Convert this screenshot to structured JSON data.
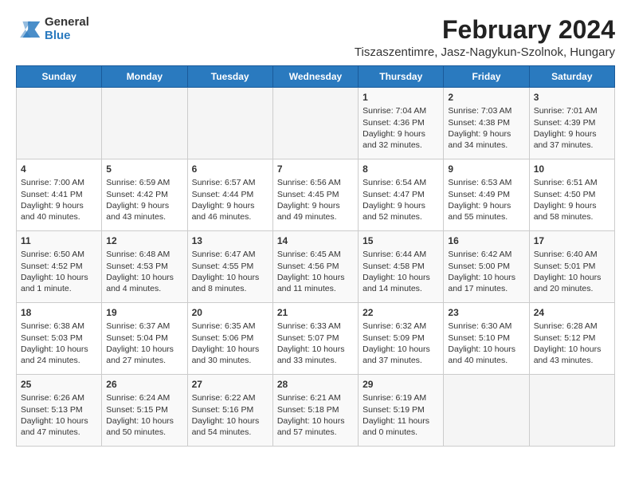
{
  "logo": {
    "general": "General",
    "blue": "Blue"
  },
  "title": "February 2024",
  "subtitle": "Tiszaszentimre, Jasz-Nagykun-Szolnok, Hungary",
  "header": {
    "days": [
      "Sunday",
      "Monday",
      "Tuesday",
      "Wednesday",
      "Thursday",
      "Friday",
      "Saturday"
    ]
  },
  "weeks": [
    {
      "cells": [
        {
          "day": "",
          "info": ""
        },
        {
          "day": "",
          "info": ""
        },
        {
          "day": "",
          "info": ""
        },
        {
          "day": "",
          "info": ""
        },
        {
          "day": "1",
          "info": "Sunrise: 7:04 AM\nSunset: 4:36 PM\nDaylight: 9 hours\nand 32 minutes."
        },
        {
          "day": "2",
          "info": "Sunrise: 7:03 AM\nSunset: 4:38 PM\nDaylight: 9 hours\nand 34 minutes."
        },
        {
          "day": "3",
          "info": "Sunrise: 7:01 AM\nSunset: 4:39 PM\nDaylight: 9 hours\nand 37 minutes."
        }
      ]
    },
    {
      "cells": [
        {
          "day": "4",
          "info": "Sunrise: 7:00 AM\nSunset: 4:41 PM\nDaylight: 9 hours\nand 40 minutes."
        },
        {
          "day": "5",
          "info": "Sunrise: 6:59 AM\nSunset: 4:42 PM\nDaylight: 9 hours\nand 43 minutes."
        },
        {
          "day": "6",
          "info": "Sunrise: 6:57 AM\nSunset: 4:44 PM\nDaylight: 9 hours\nand 46 minutes."
        },
        {
          "day": "7",
          "info": "Sunrise: 6:56 AM\nSunset: 4:45 PM\nDaylight: 9 hours\nand 49 minutes."
        },
        {
          "day": "8",
          "info": "Sunrise: 6:54 AM\nSunset: 4:47 PM\nDaylight: 9 hours\nand 52 minutes."
        },
        {
          "day": "9",
          "info": "Sunrise: 6:53 AM\nSunset: 4:49 PM\nDaylight: 9 hours\nand 55 minutes."
        },
        {
          "day": "10",
          "info": "Sunrise: 6:51 AM\nSunset: 4:50 PM\nDaylight: 9 hours\nand 58 minutes."
        }
      ]
    },
    {
      "cells": [
        {
          "day": "11",
          "info": "Sunrise: 6:50 AM\nSunset: 4:52 PM\nDaylight: 10 hours\nand 1 minute."
        },
        {
          "day": "12",
          "info": "Sunrise: 6:48 AM\nSunset: 4:53 PM\nDaylight: 10 hours\nand 4 minutes."
        },
        {
          "day": "13",
          "info": "Sunrise: 6:47 AM\nSunset: 4:55 PM\nDaylight: 10 hours\nand 8 minutes."
        },
        {
          "day": "14",
          "info": "Sunrise: 6:45 AM\nSunset: 4:56 PM\nDaylight: 10 hours\nand 11 minutes."
        },
        {
          "day": "15",
          "info": "Sunrise: 6:44 AM\nSunset: 4:58 PM\nDaylight: 10 hours\nand 14 minutes."
        },
        {
          "day": "16",
          "info": "Sunrise: 6:42 AM\nSunset: 5:00 PM\nDaylight: 10 hours\nand 17 minutes."
        },
        {
          "day": "17",
          "info": "Sunrise: 6:40 AM\nSunset: 5:01 PM\nDaylight: 10 hours\nand 20 minutes."
        }
      ]
    },
    {
      "cells": [
        {
          "day": "18",
          "info": "Sunrise: 6:38 AM\nSunset: 5:03 PM\nDaylight: 10 hours\nand 24 minutes."
        },
        {
          "day": "19",
          "info": "Sunrise: 6:37 AM\nSunset: 5:04 PM\nDaylight: 10 hours\nand 27 minutes."
        },
        {
          "day": "20",
          "info": "Sunrise: 6:35 AM\nSunset: 5:06 PM\nDaylight: 10 hours\nand 30 minutes."
        },
        {
          "day": "21",
          "info": "Sunrise: 6:33 AM\nSunset: 5:07 PM\nDaylight: 10 hours\nand 33 minutes."
        },
        {
          "day": "22",
          "info": "Sunrise: 6:32 AM\nSunset: 5:09 PM\nDaylight: 10 hours\nand 37 minutes."
        },
        {
          "day": "23",
          "info": "Sunrise: 6:30 AM\nSunset: 5:10 PM\nDaylight: 10 hours\nand 40 minutes."
        },
        {
          "day": "24",
          "info": "Sunrise: 6:28 AM\nSunset: 5:12 PM\nDaylight: 10 hours\nand 43 minutes."
        }
      ]
    },
    {
      "cells": [
        {
          "day": "25",
          "info": "Sunrise: 6:26 AM\nSunset: 5:13 PM\nDaylight: 10 hours\nand 47 minutes."
        },
        {
          "day": "26",
          "info": "Sunrise: 6:24 AM\nSunset: 5:15 PM\nDaylight: 10 hours\nand 50 minutes."
        },
        {
          "day": "27",
          "info": "Sunrise: 6:22 AM\nSunset: 5:16 PM\nDaylight: 10 hours\nand 54 minutes."
        },
        {
          "day": "28",
          "info": "Sunrise: 6:21 AM\nSunset: 5:18 PM\nDaylight: 10 hours\nand 57 minutes."
        },
        {
          "day": "29",
          "info": "Sunrise: 6:19 AM\nSunset: 5:19 PM\nDaylight: 11 hours\nand 0 minutes."
        },
        {
          "day": "",
          "info": ""
        },
        {
          "day": "",
          "info": ""
        }
      ]
    }
  ]
}
